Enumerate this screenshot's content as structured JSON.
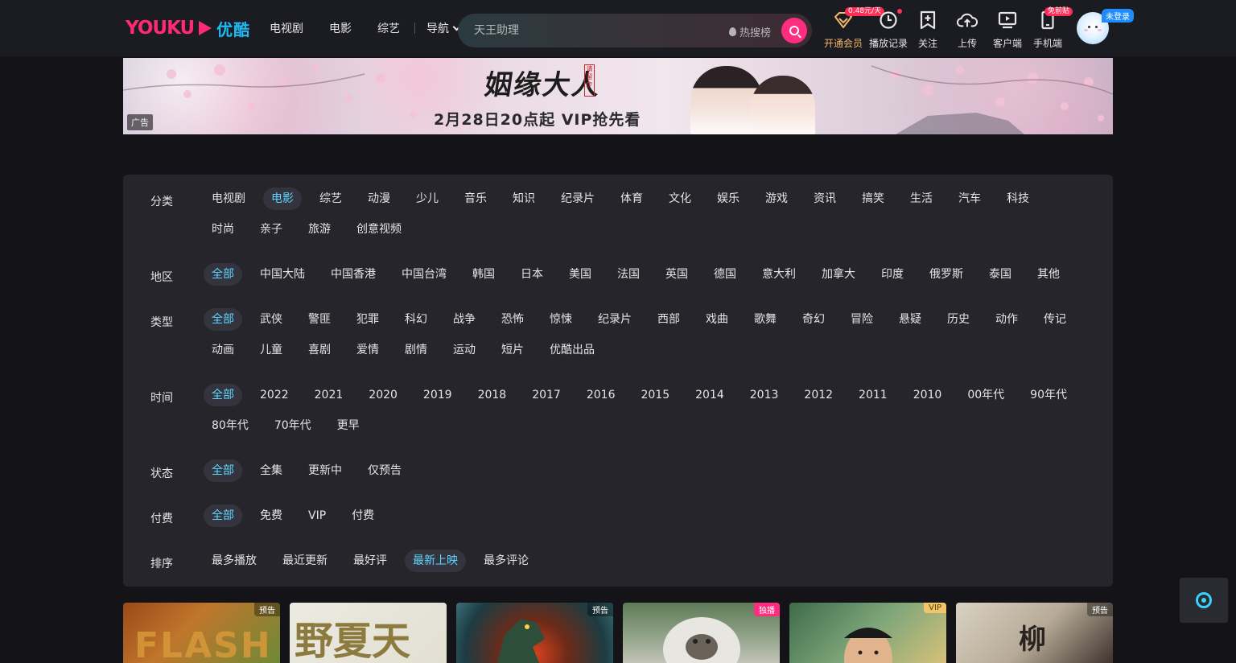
{
  "header": {
    "logo_text": "YOUKU",
    "logo_cn": "优酷",
    "nav": [
      "电视剧",
      "电影",
      "综艺"
    ],
    "guide_label": "导航",
    "search": {
      "placeholder": "天王助理",
      "hot_label": "热搜榜"
    },
    "tools": {
      "vip": {
        "label": "开通会员",
        "tag": "0.48元/天"
      },
      "history": {
        "label": "播放记录"
      },
      "follow": {
        "label": "关注"
      },
      "upload": {
        "label": "上传"
      },
      "client": {
        "label": "客户端"
      },
      "mobile": {
        "label": "手机端",
        "tag": "免前贴"
      }
    },
    "login_badge": "未登录"
  },
  "banner": {
    "title": "姻缘大人",
    "seal": "请留步",
    "subtitle": "2月28日20点起 VIP抢先看",
    "ad_label": "广告"
  },
  "filters": [
    {
      "label": "分类",
      "active": "电影",
      "options": [
        "电视剧",
        "电影",
        "综艺",
        "动漫",
        "少儿",
        "音乐",
        "知识",
        "纪录片",
        "体育",
        "文化",
        "娱乐",
        "游戏",
        "资讯",
        "搞笑",
        "生活",
        "汽车",
        "科技",
        "时尚",
        "亲子",
        "旅游",
        "创意视频"
      ]
    },
    {
      "label": "地区",
      "active": "全部",
      "options": [
        "全部",
        "中国大陆",
        "中国香港",
        "中国台湾",
        "韩国",
        "日本",
        "美国",
        "法国",
        "英国",
        "德国",
        "意大利",
        "加拿大",
        "印度",
        "俄罗斯",
        "泰国",
        "其他"
      ]
    },
    {
      "label": "类型",
      "active": "全部",
      "options": [
        "全部",
        "武侠",
        "警匪",
        "犯罪",
        "科幻",
        "战争",
        "恐怖",
        "惊悚",
        "纪录片",
        "西部",
        "戏曲",
        "歌舞",
        "奇幻",
        "冒险",
        "悬疑",
        "历史",
        "动作",
        "传记",
        "动画",
        "儿童",
        "喜剧",
        "爱情",
        "剧情",
        "运动",
        "短片",
        "优酷出品"
      ]
    },
    {
      "label": "时间",
      "active": "全部",
      "options": [
        "全部",
        "2022",
        "2021",
        "2020",
        "2019",
        "2018",
        "2017",
        "2016",
        "2015",
        "2014",
        "2013",
        "2012",
        "2011",
        "2010",
        "00年代",
        "90年代",
        "80年代",
        "70年代",
        "更早"
      ]
    },
    {
      "label": "状态",
      "active": "全部",
      "options": [
        "全部",
        "全集",
        "更新中",
        "仅预告"
      ]
    },
    {
      "label": "付费",
      "active": "全部",
      "options": [
        "全部",
        "免费",
        "VIP",
        "付费"
      ]
    },
    {
      "label": "排序",
      "active": "最新上映",
      "options": [
        "最多播放",
        "最近更新",
        "最好评",
        "最新上映",
        "最多评论"
      ]
    }
  ],
  "thumbnails": [
    {
      "badge": "预告",
      "badge_style": "plain",
      "art": "FLASH"
    },
    {
      "badge": "",
      "badge_style": "plain",
      "art": "野夏天"
    },
    {
      "badge": "预告",
      "badge_style": "plain",
      "art": ""
    },
    {
      "badge": "独播",
      "badge_style": "pink",
      "art": ""
    },
    {
      "badge": "VIP",
      "badge_style": "gold",
      "art": ""
    },
    {
      "badge": "预告",
      "badge_style": "plain",
      "art": "柳"
    }
  ],
  "colors": {
    "accent": "#ff2d80",
    "active_text": "#60d6ff",
    "vip": "#f3b86b",
    "panel": "#25252b"
  }
}
